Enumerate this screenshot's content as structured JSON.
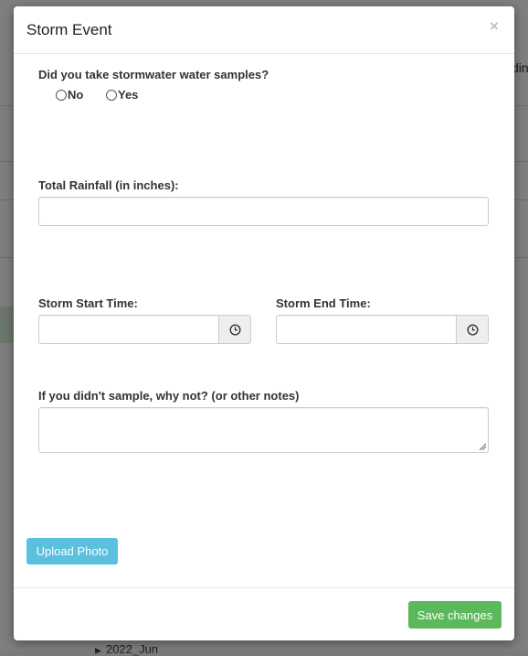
{
  "background": {
    "right_text": "din",
    "bottom_item": "2022_Jun"
  },
  "modal": {
    "title": "Storm Event",
    "close_symbol": "×",
    "samples_question": "Did you take stormwater water samples?",
    "radio_no": "No",
    "radio_yes": "Yes",
    "rainfall_label": "Total Rainfall (in inches):",
    "start_label": "Storm Start Time:",
    "end_label": "Storm End Time:",
    "notes_label": "If you didn't sample, why not? (or other notes)",
    "upload_label": "Upload Photo",
    "save_label": "Save changes"
  },
  "icons": {
    "start_time": "clock-icon",
    "end_time": "clock-icon"
  },
  "colors": {
    "upload_button": "#5bc0de",
    "save_button": "#5cb85c"
  }
}
